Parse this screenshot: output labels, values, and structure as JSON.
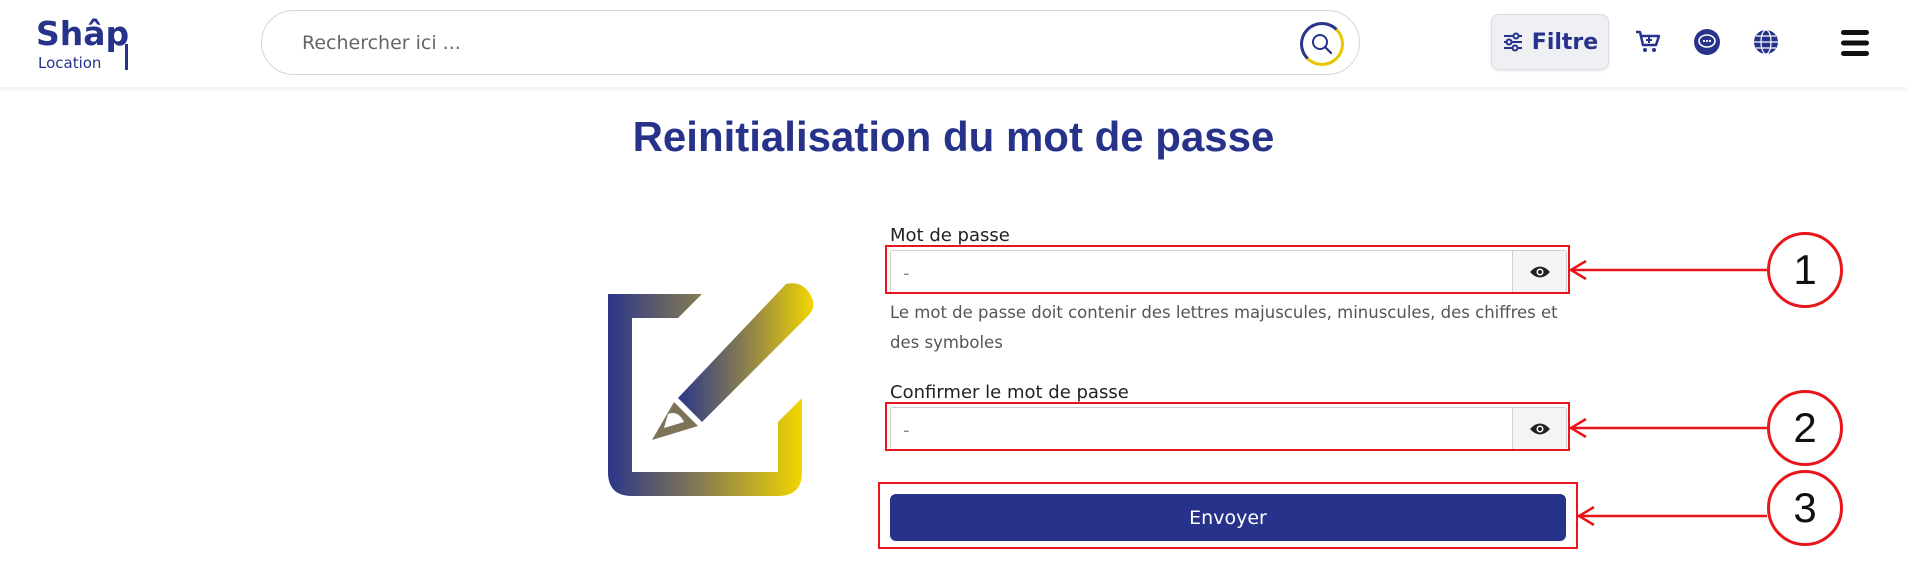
{
  "header": {
    "logo_line1": "Shâp",
    "logo_line2": "Location",
    "search_placeholder": "Rechercher ici ...",
    "filter_label": "Filtre"
  },
  "page": {
    "title": "Reinitialisation du mot de passe"
  },
  "form": {
    "password_label": "Mot de passe",
    "password_value": "-",
    "password_hint": "Le mot de passe doit contenir des lettres majuscules, minuscules, des chiffres et des symboles",
    "confirm_label": "Confirmer le mot de passe",
    "confirm_value": "-",
    "submit_label": "Envoyer"
  },
  "annotations": {
    "n1": "1",
    "n2": "2",
    "n3": "3"
  },
  "colors": {
    "brand": "#27338a",
    "accent": "#e9c500",
    "annotation": "#e8151b"
  },
  "icons": {
    "search": "search-icon",
    "filter": "sliders-icon",
    "cart": "cart-icon",
    "chat": "chat-icon",
    "language": "globe-icon",
    "menu": "hamburger-menu-icon",
    "visibility": "eye-icon"
  }
}
